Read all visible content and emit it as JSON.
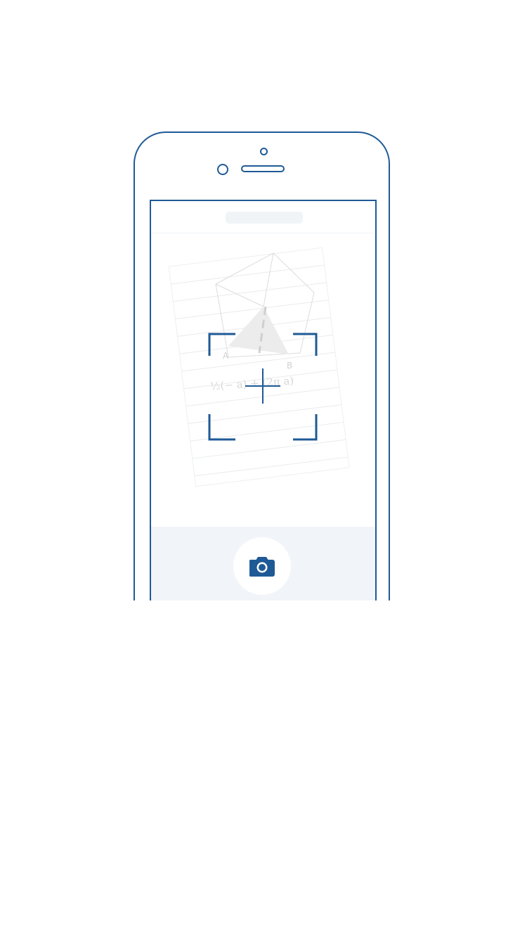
{
  "colors": {
    "accent": "#1f5a96",
    "panel_background": "#f1f4f8",
    "page_background": "#ffffff",
    "paper_lines": "#e6e9ec",
    "sketch_gray": "#d6d6d6"
  },
  "phone": {
    "model": "iphone-outline"
  },
  "screen": {
    "top_bar": {
      "title_placeholder": "title-placeholder"
    },
    "viewfinder": {
      "content": "paper-with-geometry-sketch",
      "handwriting": {
        "label_a": "A",
        "label_b": "B",
        "formula": "½(− a) + (2π a)"
      },
      "focus_frame_icon": "focus-frame-icon",
      "crosshair_icon": "crosshair-icon"
    },
    "bottom_bar": {
      "shutter_icon": "camera-icon"
    }
  }
}
